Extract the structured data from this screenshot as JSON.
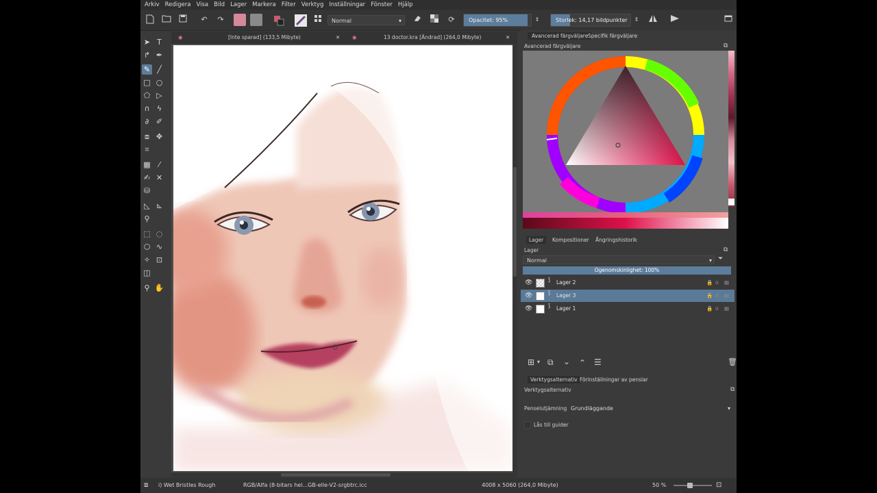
{
  "menu": [
    "Arkiv",
    "Redigera",
    "Visa",
    "Bild",
    "Lager",
    "Markera",
    "Filter",
    "Verktyg",
    "Inställningar",
    "Fönster",
    "Hjälp"
  ],
  "toolbar": {
    "blend_mode": "Normal",
    "opacity_label": "Opacitet: 95%",
    "opacity_value": 0.95,
    "size_label": "Storlek: 14,17 bildpunkter",
    "fg_color": "#d48a9a",
    "bg_color": "#8a8a8a"
  },
  "doc_tabs": [
    {
      "label": "[Inte sparad]  (133,5 Mibyte)"
    },
    {
      "label": "13 doctor.kra [Ändrad]  (264,0 Mibyte)"
    }
  ],
  "color_docker": {
    "tab_advanced": "Avancerad färgväljare",
    "tab_specific": "Specifik färgväljare",
    "title": "Avancerad färgväljare"
  },
  "layers_docker": {
    "tab_layers": "Lager",
    "tab_compositions": "Kompositioner",
    "tab_undo": "Ångringshistorik",
    "title": "Lager",
    "blend_mode": "Normal",
    "opacity_label": "Ogenomskinlighet:  100%",
    "layers": [
      {
        "name": "Lager 2",
        "selected": false
      },
      {
        "name": "Lager 3",
        "selected": true
      },
      {
        "name": "Lager 1",
        "selected": false
      }
    ]
  },
  "tool_options": {
    "tab_tool": "Verktygsalternativ",
    "tab_brush": "Förinställningar av penslar",
    "title": "Verktygsalternativ",
    "smoothing_label": "Penselutjämning:",
    "smoothing_value": "Grundläggande",
    "snap_label": "Lås till guider"
  },
  "status": {
    "brush": "i) Wet Bristles Rough",
    "color_space": "RGB/Alfa (8-bitars hel...GB-elle-V2-srgbtrc.icc",
    "dimensions": "4008 x 5060 (264,0 Mibyte)",
    "zoom": "50 %"
  }
}
